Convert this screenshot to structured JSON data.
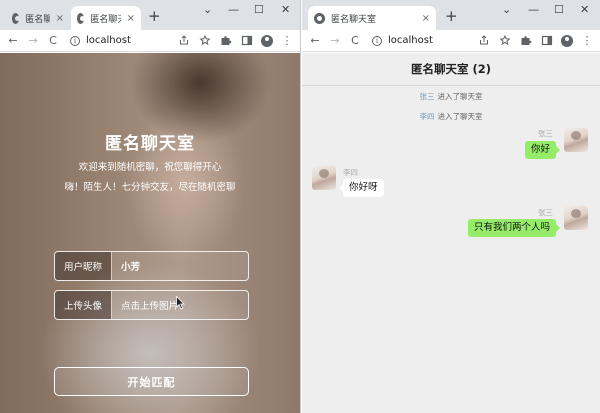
{
  "left_window": {
    "tabs": [
      {
        "label": "匿名聊天",
        "close": "×"
      },
      {
        "label": "匿名聊天室",
        "close": "×"
      }
    ],
    "new_tab": "+",
    "controls": {
      "dropdown": "⌄",
      "minimize": "—",
      "maximize": "☐",
      "close": "✕"
    },
    "toolbar": {
      "back": "←",
      "forward": "→",
      "reload": "C",
      "url": "localhost"
    }
  },
  "right_window": {
    "tabs": [
      {
        "label": "匿名聊天室",
        "close": "×"
      }
    ],
    "new_tab": "+",
    "controls": {
      "dropdown": "⌄",
      "minimize": "—",
      "maximize": "☐",
      "close": "✕"
    },
    "toolbar": {
      "back": "←",
      "forward": "→",
      "reload": "C",
      "url": "localhost"
    }
  },
  "login": {
    "title": "匿名聊天室",
    "subtitle_line1": "欢迎来到随机密聊，祝您聊得开心",
    "subtitle_line2": "嗨！陌生人！七分钟交友，尽在随机密聊",
    "nickname_label": "用户昵称",
    "nickname_value": "小芳",
    "avatar_label": "上传头像",
    "avatar_placeholder": "点击上传图片",
    "start_button": "开始匹配"
  },
  "chat": {
    "title": "匿名聊天室",
    "count": "(2)",
    "system_messages": [
      {
        "name": "张三",
        "text": "进入了聊天室"
      },
      {
        "name": "李四",
        "text": "进入了聊天室"
      }
    ],
    "messages": [
      {
        "sender": "张三",
        "text": "你好",
        "side": "right"
      },
      {
        "sender": "李四",
        "text": "你好呀",
        "side": "left"
      },
      {
        "sender": "张三",
        "text": "只有我们两个人吗",
        "side": "right"
      }
    ]
  },
  "icons": {
    "favicon": "globe-icon",
    "info": "info-icon",
    "share": "share-icon",
    "star": "star-icon",
    "extensions": "puzzle-icon",
    "sidepanel": "sidepanel-icon",
    "profile": "profile-icon",
    "menu": "kebab-menu-icon"
  },
  "colors": {
    "my_bubble": "#95ec69",
    "other_bubble": "#ffffff",
    "system_name": "#6d9ac5",
    "chat_bg": "#eeeeee",
    "tabstrip": "#dee1e6"
  }
}
